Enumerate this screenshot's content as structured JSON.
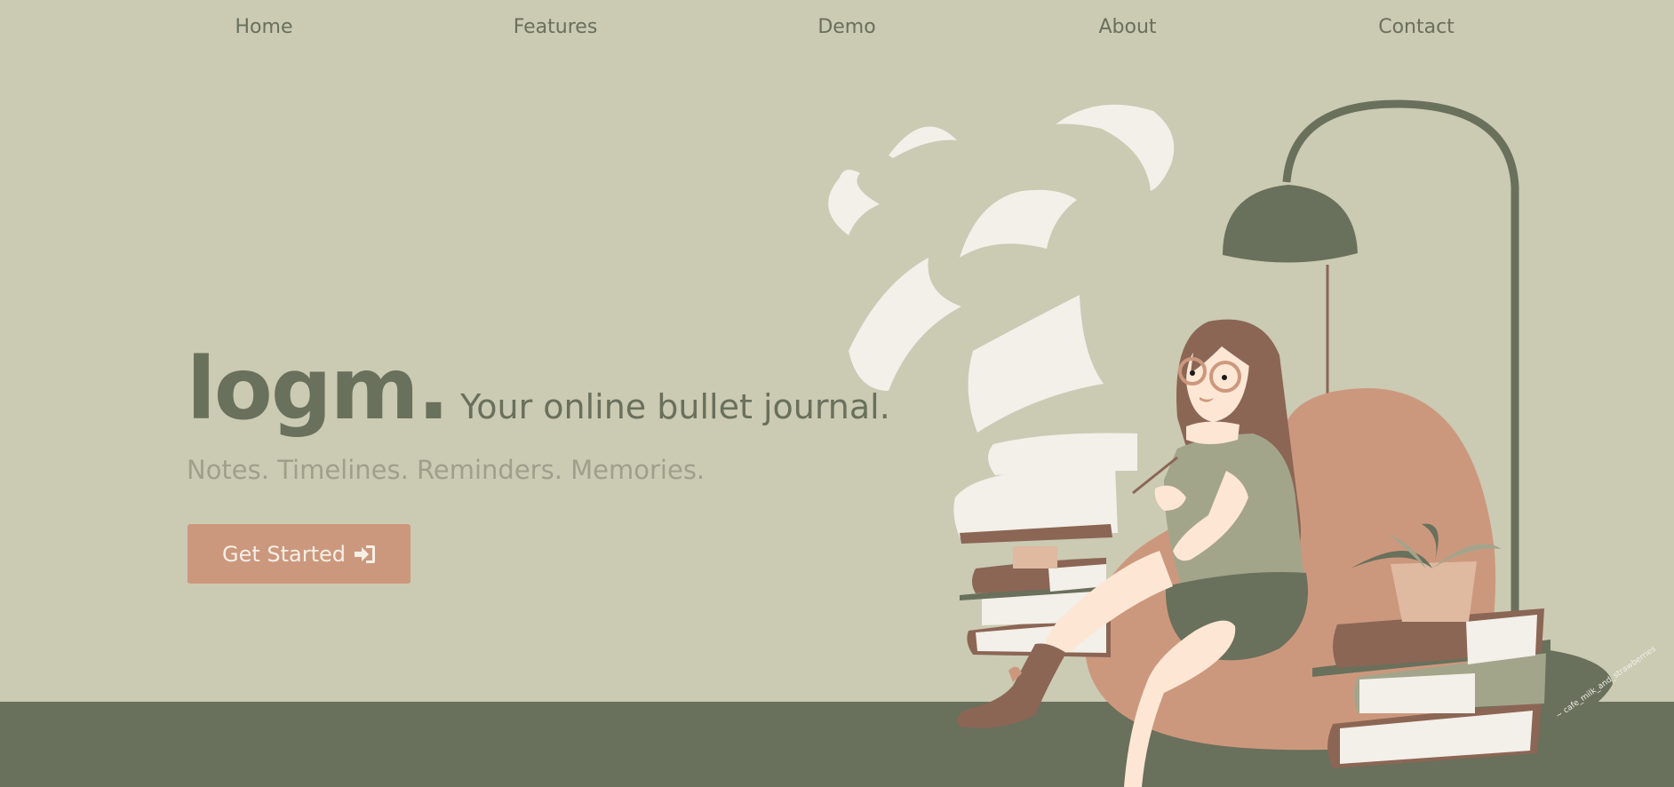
{
  "nav": {
    "items": [
      {
        "label": "Home"
      },
      {
        "label": "Features"
      },
      {
        "label": "Demo"
      },
      {
        "label": "About"
      },
      {
        "label": "Contact"
      }
    ]
  },
  "hero": {
    "logo": "logm.",
    "tagline": "Your online bullet journal.",
    "subline": "Notes. Timelines. Reminders. Memories.",
    "cta_label": "Get Started",
    "cta_icon": "sign-in-icon"
  },
  "illustration": {
    "signature": "~ cafe_milk_and_strawberries"
  },
  "colors": {
    "background": "#cbcab3",
    "floor": "#69705b",
    "accent": "#cc987d",
    "text_primary": "#69705b",
    "text_muted": "#9fa08b"
  }
}
